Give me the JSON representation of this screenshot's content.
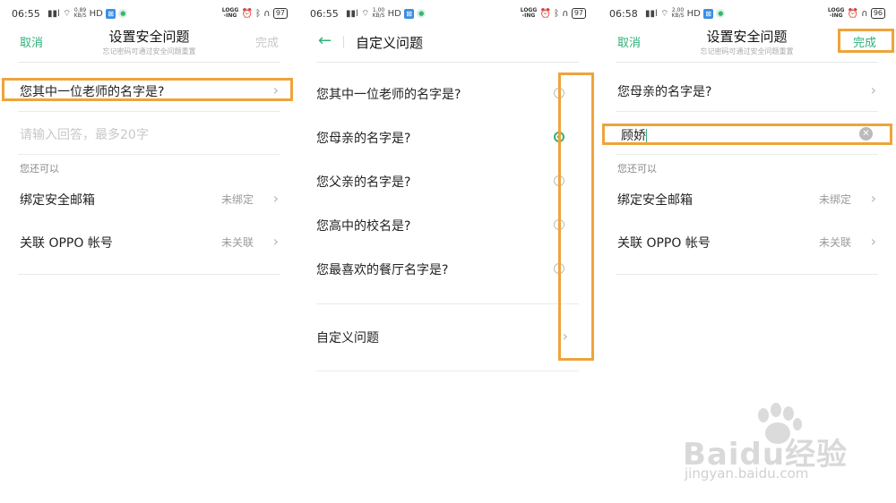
{
  "colors": {
    "accent": "#2fb07a",
    "highlight": "#eea43a",
    "muted": "#999999"
  },
  "panel1": {
    "status": {
      "time": "06:55",
      "signal": "ឈឈl",
      "speed_top": "0.89",
      "speed_bottom": "KB/S",
      "hd": "HD",
      "logg_top": "LOGG",
      "logg_bottom": "-ING",
      "battery": "97"
    },
    "header": {
      "cancel": "取消",
      "title": "设置安全问题",
      "subtitle": "忘记密码可通过安全问题重置",
      "done": "完成"
    },
    "question": "您其中一位老师的名字是?",
    "answer_placeholder": "请输入回答，最多20字",
    "section_label": "您还可以",
    "rows": [
      {
        "label": "绑定安全邮箱",
        "value": "未绑定"
      },
      {
        "label": "关联 OPPO 帐号",
        "value": "未关联"
      }
    ]
  },
  "panel2": {
    "status": {
      "time": "06:55",
      "speed_top": "1.00",
      "speed_bottom": "KB/S",
      "hd": "HD",
      "logg_top": "LOGG",
      "logg_bottom": "-ING",
      "battery": "97"
    },
    "header": {
      "title": "自定义问题"
    },
    "options": [
      {
        "label": "您其中一位老师的名字是?",
        "checked": false
      },
      {
        "label": "您母亲的名字是?",
        "checked": true
      },
      {
        "label": "您父亲的名字是?",
        "checked": false
      },
      {
        "label": "您高中的校名是?",
        "checked": false
      },
      {
        "label": "您最喜欢的餐厅名字是?",
        "checked": false
      }
    ],
    "custom_label": "自定义问题"
  },
  "panel3": {
    "status": {
      "time": "06:58",
      "speed_top": "2.00",
      "speed_bottom": "KB/S",
      "hd": "HD",
      "logg_top": "LOGG",
      "logg_bottom": "-ING",
      "battery": "96"
    },
    "header": {
      "cancel": "取消",
      "title": "设置安全问题",
      "subtitle": "忘记密码可通过安全问题重置",
      "done": "完成"
    },
    "question": "您母亲的名字是?",
    "answer": "顾娇",
    "section_label": "您还可以",
    "rows": [
      {
        "label": "绑定安全邮箱",
        "value": "未绑定"
      },
      {
        "label": "关联 OPPO 帐号",
        "value": "未关联"
      }
    ]
  },
  "watermark": {
    "brand": "Bai",
    "brand2": "du",
    "brand3": "经验",
    "url": "jingyan.baidu.com"
  }
}
